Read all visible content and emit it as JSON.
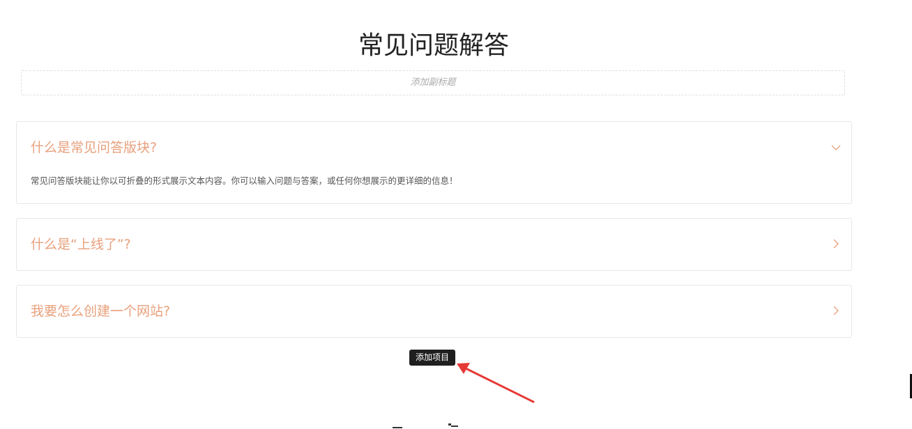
{
  "faq": {
    "title": "常见问题解答",
    "subtitle_placeholder": "添加副标题",
    "items": [
      {
        "question": "什么是常见问答版块?",
        "answer": "常见问答版块能让你以可折叠的形式展示文本内容。你可以输入问题与答案，或任何你想展示的更详细的信息！",
        "expanded": true,
        "icon": "chevron-down-icon"
      },
      {
        "question": "什么是“上线了”?",
        "expanded": false,
        "icon": "chevron-right-icon"
      },
      {
        "question": "我要怎么创建一个网站?",
        "expanded": false,
        "icon": "chevron-right-icon"
      }
    ],
    "add_item_label": "添加项目"
  },
  "colors": {
    "question": "#e8a07c",
    "annotation_arrow": "#e53935",
    "tooltip_bg": "#1f1f1f"
  }
}
